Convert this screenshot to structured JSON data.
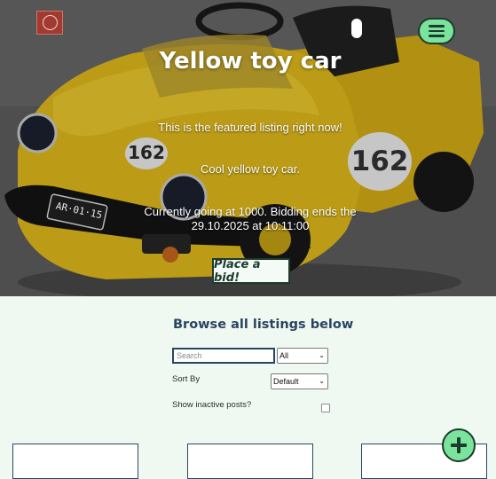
{
  "nav": {
    "logo_icon": "brand-logo-icon",
    "toggle_icon": "toggle-pill-icon",
    "menu_icon": "hamburger-icon"
  },
  "hero": {
    "title": "Yellow toy car",
    "featured_text": "This is the featured listing right now!",
    "description": "Cool yellow toy car.",
    "bid_line_1": "Currently going at 1000. Bidding ends the",
    "bid_line_2": "29.10.2025 at 10:11:00",
    "bid_button": "Place a bid!",
    "image_labels": {
      "number_left": "162",
      "number_right": "162",
      "plate": "AR·01·15"
    }
  },
  "browse": {
    "title": "Browse all listings below",
    "search_placeholder": "Search",
    "category_selected": "All",
    "sort_label": "Sort By",
    "sort_selected": "Default",
    "inactive_label": "Show inactive posts?",
    "inactive_checked": false
  },
  "fab": {
    "icon": "plus-icon"
  },
  "colors": {
    "accent_green": "#7ae39c",
    "dark_green": "#1e3b2e",
    "navy": "#2a4563",
    "page_bg": "#f0f9f1",
    "car_yellow": "#e6bf1c"
  }
}
